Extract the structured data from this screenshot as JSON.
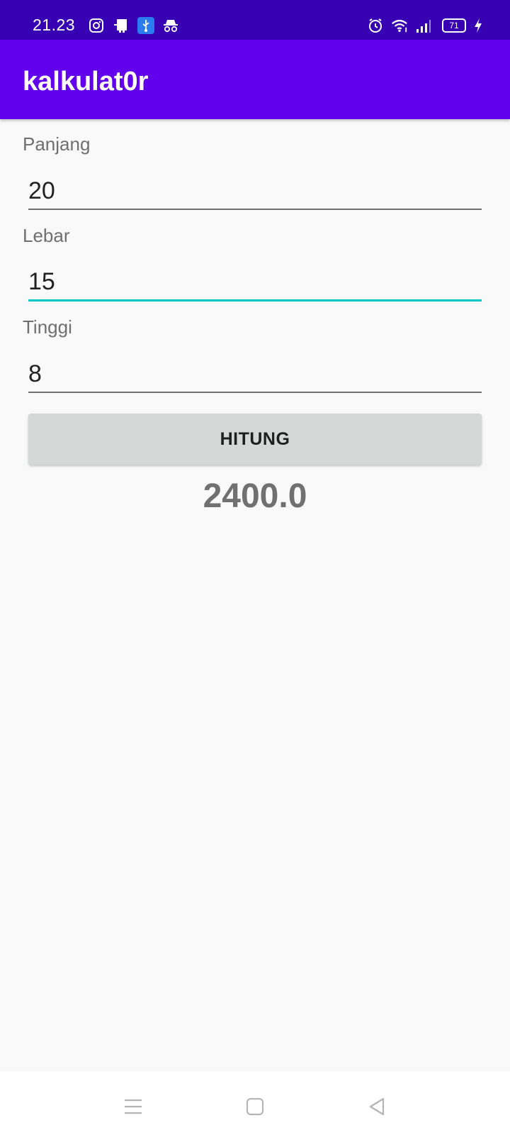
{
  "status": {
    "time": "21.23",
    "left_icons": [
      "instagram-icon",
      "notification-app-icon",
      "usb-icon",
      "incognito-icon"
    ],
    "right_icons": [
      "alarm-icon",
      "wifi-icon",
      "signal-icon",
      "battery-icon",
      "charging-icon"
    ],
    "battery": "71"
  },
  "app_bar": {
    "title": "kalkulat0r"
  },
  "form": {
    "panjang": {
      "label": "Panjang",
      "value": "20"
    },
    "lebar": {
      "label": "Lebar",
      "value": "15"
    },
    "tinggi": {
      "label": "Tinggi",
      "value": "8"
    }
  },
  "button": {
    "label": "HITUNG"
  },
  "result": {
    "value": "2400.0"
  },
  "colors": {
    "status_bar": "#3700b3",
    "app_bar": "#6200ee",
    "accent": "#03c8c8",
    "button": "#d6d7d7"
  },
  "nav": {
    "icons": [
      "menu-icon",
      "home-icon",
      "back-icon"
    ]
  }
}
